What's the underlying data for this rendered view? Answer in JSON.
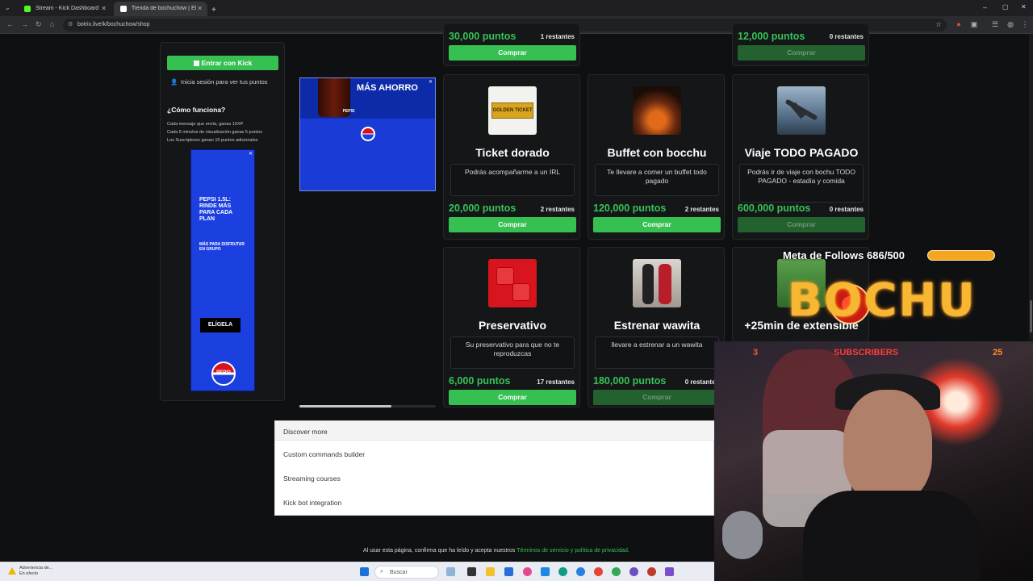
{
  "browser": {
    "tabs": [
      {
        "label": "Stream - Kick Dashboard",
        "active": false,
        "favicon_color": "#53fc18"
      },
      {
        "label": "Tienda de bochuchow | El mejor",
        "active": true,
        "favicon_color": "#ffffff"
      }
    ],
    "url": "botrix.live/k/bochuchow/shop",
    "new_tab": "+"
  },
  "sidebar": {
    "login_button": "Entrar con Kick",
    "login_hint": "Inicia sesión para ver tus puntos",
    "how_title": "¿Cómo funciona?",
    "how_lines": [
      "Cada mensaje que envía, ganas 10XP",
      "Cada 5 minutos de visualización ganas 5 puntos",
      "Los Suscriptores ganan 10 puntos adicionales"
    ],
    "ad": {
      "headline": "PEPSI 1.5L: RINDE MÁS PARA CADA PLAN",
      "sub": "MÁS PARA DISFRUTAR EN GRUPO",
      "cta": "ELÍGELA",
      "brand": "PEPSI"
    }
  },
  "top_ad": {
    "headline": "MÁS AHORRO",
    "brand": "PEPSI"
  },
  "top_row": [
    {
      "price": "30,000 puntos",
      "stock": "1 restantes",
      "buy": "Comprar",
      "disabled": false
    },
    {
      "price": "12,000 puntos",
      "stock": "0 restantes",
      "buy": "Comprar",
      "disabled": true
    }
  ],
  "products": [
    {
      "name": "Ticket dorado",
      "description": "Podrás acompañarme a un IRL",
      "price": "20,000 puntos",
      "stock": "2 restantes",
      "buy": "Comprar",
      "disabled": false,
      "image": "golden-ticket"
    },
    {
      "name": "Buffet con bocchu",
      "description": "Te llevare a comer un buffet todo pagado",
      "price": "120,000 puntos",
      "stock": "2 restantes",
      "buy": "Comprar",
      "disabled": false,
      "image": "steak"
    },
    {
      "name": "Viaje TODO PAGADO",
      "description": "Podrás ir de viaje con bochu TODO PAGADO - estadía y comida",
      "price": "600,000 puntos",
      "stock": "0 restantes",
      "buy": "Comprar",
      "disabled": true,
      "image": "airplane"
    },
    {
      "name": "Preservativo",
      "description": "Su preservativo para que no te reproduzcas",
      "price": "6,000 puntos",
      "stock": "17 restantes",
      "buy": "Comprar",
      "disabled": false,
      "image": "condom"
    },
    {
      "name": "Estrenar wawita",
      "description": "llevare a estrenar a un wawita",
      "price": "180,000 puntos",
      "stock": "0 restantes",
      "buy": "Comprar",
      "disabled": true,
      "image": "photo"
    },
    {
      "name": "+25min de extensible",
      "description": "",
      "price": "",
      "stock": "",
      "buy": "",
      "disabled": false,
      "image": "soccer"
    }
  ],
  "discover": {
    "title": "Discover more",
    "items": [
      "Custom commands builder",
      "Streaming courses",
      "Kick bot integration"
    ]
  },
  "footer": {
    "text": "Al usar esta página, confirma que ha leído y acepta nuestros",
    "link": "Términos de servicio y política de privacidad."
  },
  "overlay": {
    "follow_goal": "Meta de Follows 686/500",
    "logo": "BOCHU",
    "subs_count": "3",
    "subs_label": "SUBSCRIBERS",
    "subs_total": "25"
  },
  "taskbar": {
    "weather_line1": "Advertencia de...",
    "weather_line2": "En efecto",
    "search": "Buscar"
  },
  "colors": {
    "accent_green": "#36c052",
    "price_green": "#34c457",
    "goal_orange": "#f7a51c"
  }
}
